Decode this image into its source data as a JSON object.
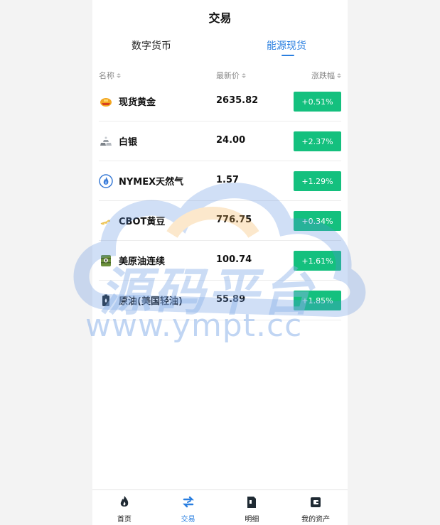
{
  "header": {
    "title": "交易"
  },
  "tabs": [
    {
      "label": "数字货币",
      "active": false
    },
    {
      "label": "能源现货",
      "active": true
    }
  ],
  "columns": {
    "name": "名称",
    "price": "最新价",
    "change": "涨跌幅"
  },
  "rows": [
    {
      "icon": "gold-bar-icon",
      "name": "现货黄金",
      "price": "2635.82",
      "change": "+0.51%"
    },
    {
      "icon": "silver-bars-icon",
      "name": "白银",
      "price": "24.00",
      "change": "+2.37%"
    },
    {
      "icon": "gas-flame-icon",
      "name": "NYMEX天然气",
      "price": "1.57",
      "change": "+1.29%"
    },
    {
      "icon": "soybean-icon",
      "name": "CBOT黄豆",
      "price": "776.75",
      "change": "+0.34%"
    },
    {
      "icon": "oil-barrel-icon",
      "name": "美原油连续",
      "price": "100.74",
      "change": "+1.61%"
    },
    {
      "icon": "oil-can-icon",
      "name": "原油(美国轻油)",
      "price": "55.89",
      "change": "+1.85%"
    }
  ],
  "colors": {
    "accent": "#2a7fe0",
    "rise": "#14c07e"
  },
  "watermark": {
    "cn": "源码平台",
    "url": "www.ympt.cc"
  },
  "tabbar": [
    {
      "icon": "flame-icon",
      "label": "首页",
      "active": false
    },
    {
      "icon": "trade-icon",
      "label": "交易",
      "active": true
    },
    {
      "icon": "document-icon",
      "label": "明细",
      "active": false
    },
    {
      "icon": "wallet-icon",
      "label": "我的资产",
      "active": false
    }
  ]
}
